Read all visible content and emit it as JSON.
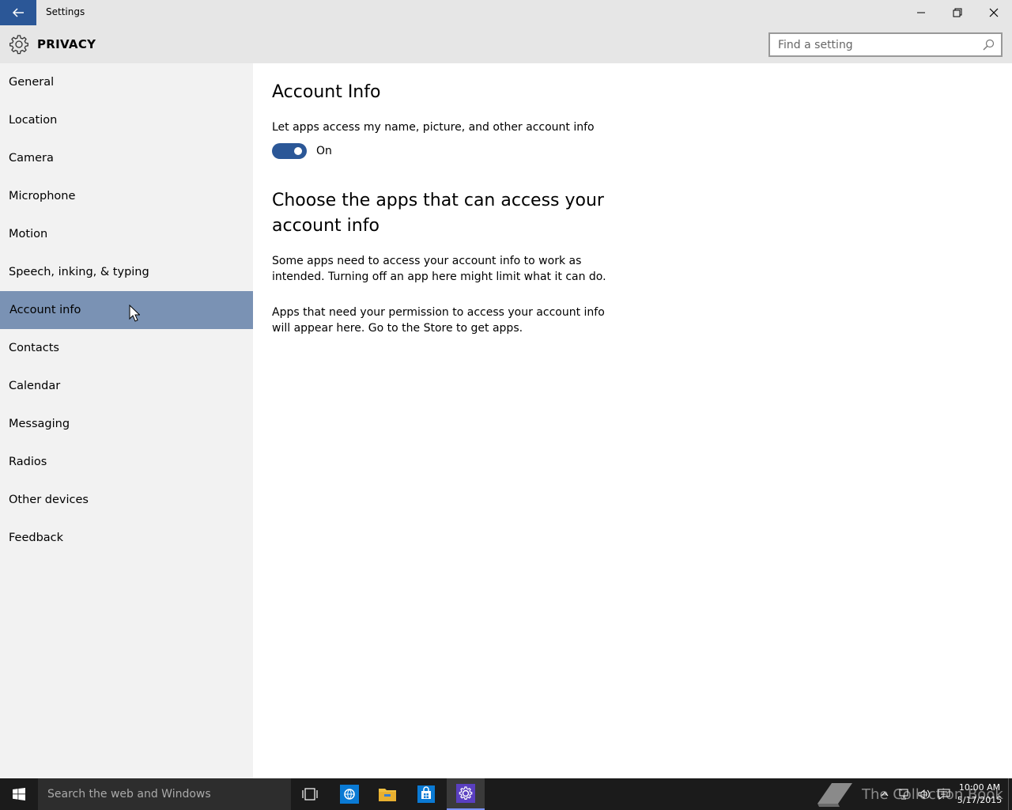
{
  "window": {
    "title": "Settings"
  },
  "header": {
    "title": "PRIVACY",
    "search_placeholder": "Find a setting"
  },
  "sidebar": {
    "items": [
      {
        "label": "General"
      },
      {
        "label": "Location"
      },
      {
        "label": "Camera"
      },
      {
        "label": "Microphone"
      },
      {
        "label": "Motion"
      },
      {
        "label": "Speech, inking, & typing"
      },
      {
        "label": "Account info",
        "selected": true
      },
      {
        "label": "Contacts"
      },
      {
        "label": "Calendar"
      },
      {
        "label": "Messaging"
      },
      {
        "label": "Radios"
      },
      {
        "label": "Other devices"
      },
      {
        "label": "Feedback"
      }
    ]
  },
  "main": {
    "heading": "Account Info",
    "toggle_label": "Let apps access my name, picture, and other account info",
    "toggle_state": "On",
    "toggle_on": true,
    "subheading": "Choose the apps that can access your account info",
    "paragraph1": "Some apps need to access your account info to work as intended. Turning off an app here might limit what it can do.",
    "paragraph2": "Apps that need your permission to access your account info will appear here. Go to the Store to get apps."
  },
  "taskbar": {
    "search_placeholder": "Search the web and Windows",
    "watermark": "The Collection Book",
    "time": "10:00 AM",
    "date": "5/17/2015"
  },
  "colors": {
    "accent": "#2b5797",
    "selected_nav": "#7a92b4",
    "sidebar_bg": "#f2f2f2",
    "titlebar_bg": "#e6e6e6",
    "taskbar_bg": "#1b1b1b"
  },
  "icons": {
    "back": "arrow-left-icon",
    "header": "gear-icon",
    "search": "search-icon",
    "start": "windows-logo-icon",
    "task_view": "task-view-icon",
    "browser": "browser-icon",
    "file_explorer": "folder-icon",
    "store": "store-bag-icon",
    "settings": "gear-icon"
  }
}
